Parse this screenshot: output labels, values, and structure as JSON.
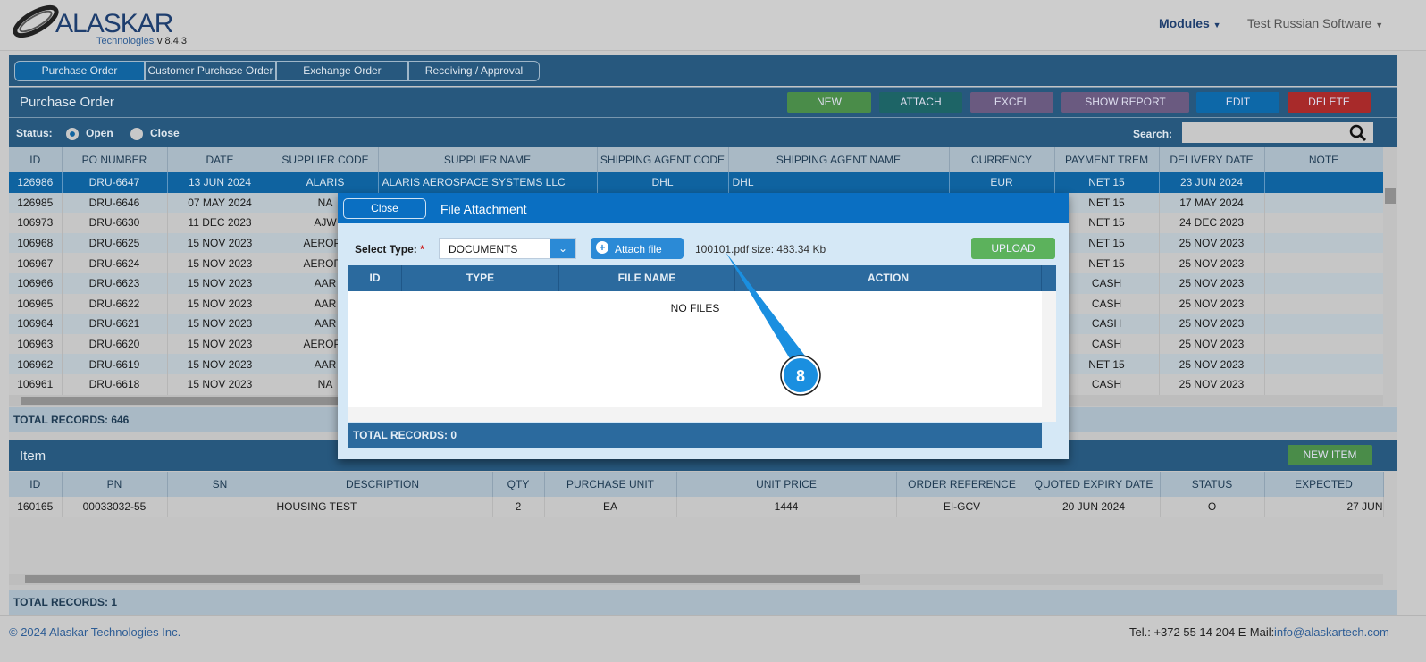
{
  "header": {
    "logo": "ALASKAR",
    "logo_sub": "Technologies",
    "version": "v 8.4.3",
    "modules": "Modules",
    "company": "Test Russian Software"
  },
  "tabs": [
    "Purchase Order",
    "Customer Purchase Order",
    "Exchange Order",
    "Receiving / Approval"
  ],
  "po_panel": {
    "title": "Purchase Order",
    "buttons": {
      "new": "NEW",
      "attach": "ATTACH",
      "excel": "EXCEL",
      "show_report": "SHOW REPORT",
      "edit": "EDIT",
      "delete": "DELETE"
    },
    "status_label": "Status:",
    "status_open": "Open",
    "status_close": "Close",
    "status_selected": "Open",
    "search_label": "Search:",
    "search_value": ""
  },
  "po_table": {
    "columns": [
      "ID",
      "PO NUMBER",
      "DATE",
      "SUPPLIER CODE",
      "SUPPLIER NAME",
      "SHIPPING AGENT CODE",
      "SHIPPING AGENT NAME",
      "CURRENCY",
      "PAYMENT TREM",
      "DELIVERY DATE",
      "NOTE"
    ],
    "rows": [
      [
        "126986",
        "DRU-6647",
        "13 JUN 2024",
        "ALARIS",
        "ALARIS AEROSPACE SYSTEMS LLC",
        "DHL",
        "DHL",
        "EUR",
        "NET 15",
        "23 JUN 2024",
        ""
      ],
      [
        "126985",
        "DRU-6646",
        "07 MAY 2024",
        "NA",
        "",
        "",
        "",
        "",
        "NET 15",
        "17 MAY 2024",
        ""
      ],
      [
        "106973",
        "DRU-6630",
        "11 DEC 2023",
        "AJW",
        "",
        "",
        "",
        "",
        "NET 15",
        "24 DEC 2023",
        ""
      ],
      [
        "106968",
        "DRU-6625",
        "15 NOV 2023",
        "AEROPA",
        "",
        "",
        "",
        "",
        "NET 15",
        "25 NOV 2023",
        ""
      ],
      [
        "106967",
        "DRU-6624",
        "15 NOV 2023",
        "AEROPA",
        "",
        "",
        "",
        "",
        "NET 15",
        "25 NOV 2023",
        ""
      ],
      [
        "106966",
        "DRU-6623",
        "15 NOV 2023",
        "AAR",
        "",
        "",
        "",
        "",
        "CASH",
        "25 NOV 2023",
        ""
      ],
      [
        "106965",
        "DRU-6622",
        "15 NOV 2023",
        "AAR",
        "",
        "",
        "",
        "",
        "CASH",
        "25 NOV 2023",
        ""
      ],
      [
        "106964",
        "DRU-6621",
        "15 NOV 2023",
        "AAR",
        "",
        "",
        "",
        "",
        "CASH",
        "25 NOV 2023",
        ""
      ],
      [
        "106963",
        "DRU-6620",
        "15 NOV 2023",
        "AEROPA",
        "",
        "",
        "",
        "",
        "CASH",
        "25 NOV 2023",
        ""
      ],
      [
        "106962",
        "DRU-6619",
        "15 NOV 2023",
        "AAR",
        "",
        "",
        "",
        "",
        "NET 15",
        "25 NOV 2023",
        ""
      ],
      [
        "106961",
        "DRU-6618",
        "15 NOV 2023",
        "NA",
        "",
        "",
        "",
        "",
        "CASH",
        "25 NOV 2023",
        ""
      ]
    ],
    "total": "TOTAL RECORDS: 646"
  },
  "item_panel": {
    "title": "Item",
    "new_item": "NEW ITEM"
  },
  "item_table": {
    "columns": [
      "ID",
      "PN",
      "SN",
      "DESCRIPTION",
      "QTY",
      "PURCHASE UNIT",
      "UNIT PRICE",
      "ORDER REFERENCE",
      "QUOTED EXPIRY DATE",
      "STATUS",
      "EXPECTED"
    ],
    "rows": [
      [
        "160165",
        "00033032-55",
        "",
        "HOUSING TEST",
        "2",
        "EA",
        "1444",
        "EI-GCV",
        "20 JUN 2024",
        "O",
        "27 JUN"
      ]
    ],
    "total": "TOTAL RECORDS: 1"
  },
  "modal": {
    "close": "Close",
    "title": "File Attachment",
    "select_type_label": "Select Type:",
    "required": "*",
    "select_type_value": "DOCUMENTS",
    "attach_file": "Attach file",
    "file_info": "100101.pdf size: 483.34 Kb",
    "upload": "UPLOAD",
    "columns": [
      "ID",
      "TYPE",
      "FILE NAME",
      "ACTION"
    ],
    "empty": "NO FILES",
    "total": "TOTAL RECORDS: 0"
  },
  "callout": {
    "number": "8",
    "color": "#1a8fe0"
  },
  "footer": {
    "copyright": "© 2024 Alaskar Technologies Inc.",
    "contact": "Tel.: +372 55 14 204 E-Mail:",
    "email": "info@alaskartech.com"
  }
}
